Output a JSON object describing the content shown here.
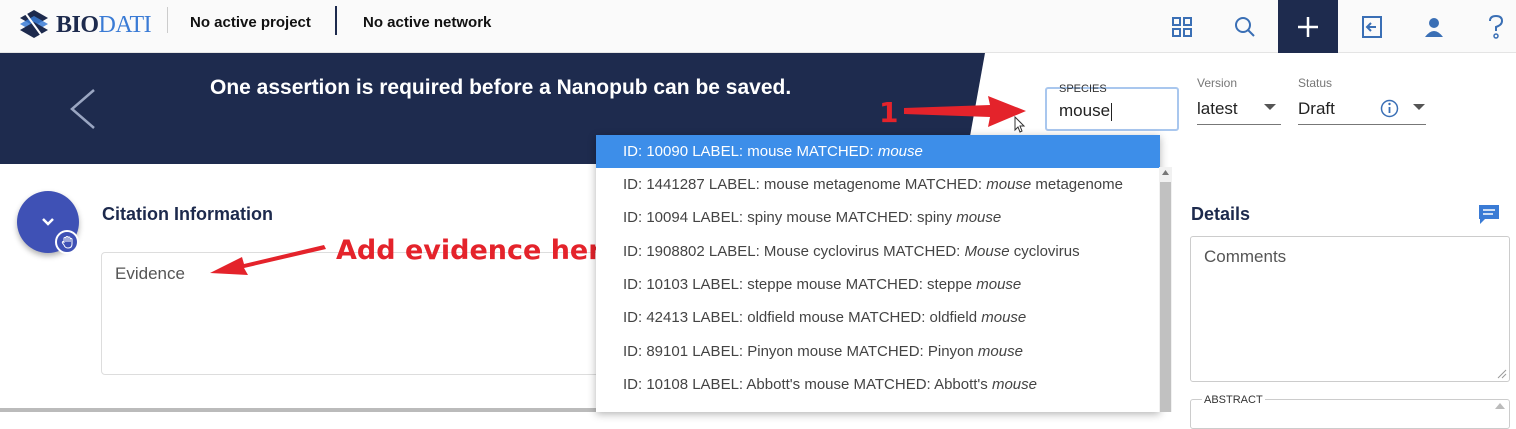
{
  "app": {
    "logo_bio": "BIO",
    "logo_dati": "DATI",
    "project": "No active project",
    "network": "No active network"
  },
  "nav_icons": [
    "grid-icon",
    "search-icon",
    "plus-icon",
    "login-icon",
    "user-icon",
    "help-icon"
  ],
  "banner": {
    "message": "One assertion is required before a Nanopub can be saved."
  },
  "species": {
    "label": "SPECIES",
    "value": "mouse"
  },
  "version": {
    "label": "Version",
    "value": "latest"
  },
  "status": {
    "label": "Status",
    "value": "Draft"
  },
  "dropdown": {
    "items": [
      {
        "prefix": "ID: 10090 LABEL: mouse MATCHED: ",
        "match": "mouse",
        "suffix": ""
      },
      {
        "prefix": "ID: 1441287 LABEL: mouse metagenome MATCHED: ",
        "match": "mouse",
        "suffix": " metagenome"
      },
      {
        "prefix": "ID: 10094 LABEL: spiny mouse MATCHED: spiny ",
        "match": "mouse",
        "suffix": ""
      },
      {
        "prefix": "ID: 1908802 LABEL: Mouse cyclovirus MATCHED: ",
        "match": "Mouse",
        "suffix": " cyclovirus"
      },
      {
        "prefix": "ID: 10103 LABEL: steppe mouse MATCHED: steppe ",
        "match": "mouse",
        "suffix": ""
      },
      {
        "prefix": "ID: 42413 LABEL: oldfield mouse MATCHED: oldfield ",
        "match": "mouse",
        "suffix": ""
      },
      {
        "prefix": "ID: 89101 LABEL: Pinyon mouse MATCHED: Pinyon ",
        "match": "mouse",
        "suffix": ""
      },
      {
        "prefix": "ID: 10108 LABEL: Abbott's mouse MATCHED: Abbott's ",
        "match": "mouse",
        "suffix": ""
      }
    ]
  },
  "citation": {
    "title": "Citation Information",
    "evidence_placeholder": "Evidence"
  },
  "details": {
    "title": "Details",
    "comments_placeholder": "Comments",
    "abstract_label": "ABSTRACT"
  },
  "annotations": {
    "step_number": "1",
    "evidence_note": "Add evidence here"
  },
  "colors": {
    "navy": "#1e2b4e",
    "accent_blue": "#3d8ee9",
    "fab": "#3f51b5",
    "annotation_red": "#e4232b"
  }
}
